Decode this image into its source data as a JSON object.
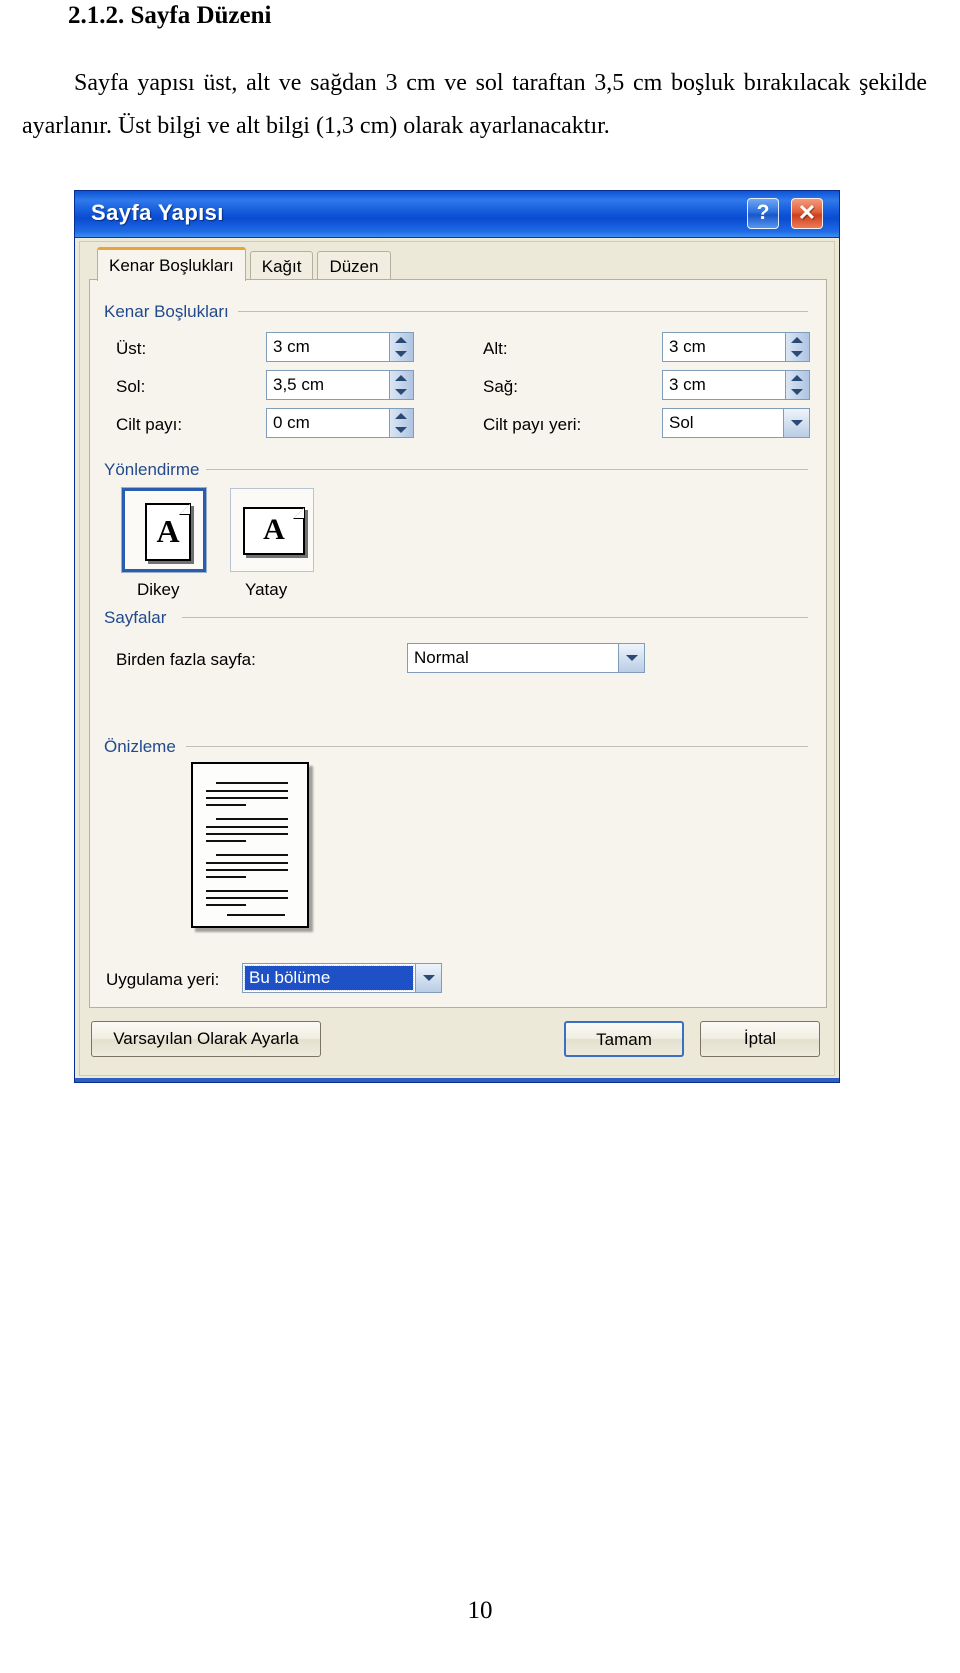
{
  "document": {
    "heading": "2.1.2. Sayfa Düzeni",
    "paragraph": "Sayfa yapısı üst, alt ve sağdan 3 cm ve sol taraftan 3,5 cm boşluk bırakılacak şekilde ayarlanır. Üst bilgi ve alt bilgi (1,3 cm) olarak ayarlanacaktır.",
    "page_number": "10"
  },
  "dialog": {
    "title": "Sayfa Yapısı",
    "titlebar_buttons": {
      "help": "?",
      "close": "✕"
    },
    "tabs": [
      {
        "label": "Kenar Boşlukları",
        "active": true
      },
      {
        "label": "Kağıt",
        "active": false
      },
      {
        "label": "Düzen",
        "active": false
      }
    ],
    "margins_group": {
      "title": "Kenar Boşlukları",
      "fields": [
        {
          "label": "Üst:",
          "value": "3 cm",
          "type": "spinner"
        },
        {
          "label": "Alt:",
          "value": "3 cm",
          "type": "spinner"
        },
        {
          "label": "Sol:",
          "value": "3,5 cm",
          "type": "spinner"
        },
        {
          "label": "Sağ:",
          "value": "3 cm",
          "type": "spinner"
        },
        {
          "label": "Cilt payı:",
          "value": "0 cm",
          "type": "spinner"
        },
        {
          "label": "Cilt payı yeri:",
          "value": "Sol",
          "type": "combo"
        }
      ]
    },
    "orientation_group": {
      "title": "Yönlendirme",
      "options": [
        {
          "label": "Dikey",
          "selected": true,
          "glyph": "A"
        },
        {
          "label": "Yatay",
          "selected": false,
          "glyph": "A"
        }
      ]
    },
    "pages_group": {
      "title": "Sayfalar",
      "multiple_pages_label": "Birden fazla sayfa:",
      "multiple_pages_value": "Normal"
    },
    "preview_group": {
      "title": "Önizleme",
      "apply_to_label": "Uygulama yeri:",
      "apply_to_value": "Bu bölüme"
    },
    "buttons": {
      "set_default": "Varsayılan Olarak Ayarla",
      "ok": "Tamam",
      "cancel": "İptal"
    }
  },
  "colors": {
    "titlebar_blue": "#1157d8",
    "group_label_blue": "#224a8c",
    "dialog_face": "#ece9d8",
    "panel_face": "#f6f4ec",
    "selection_blue": "#1f51c6",
    "accent_orange": "#e8a33d"
  }
}
